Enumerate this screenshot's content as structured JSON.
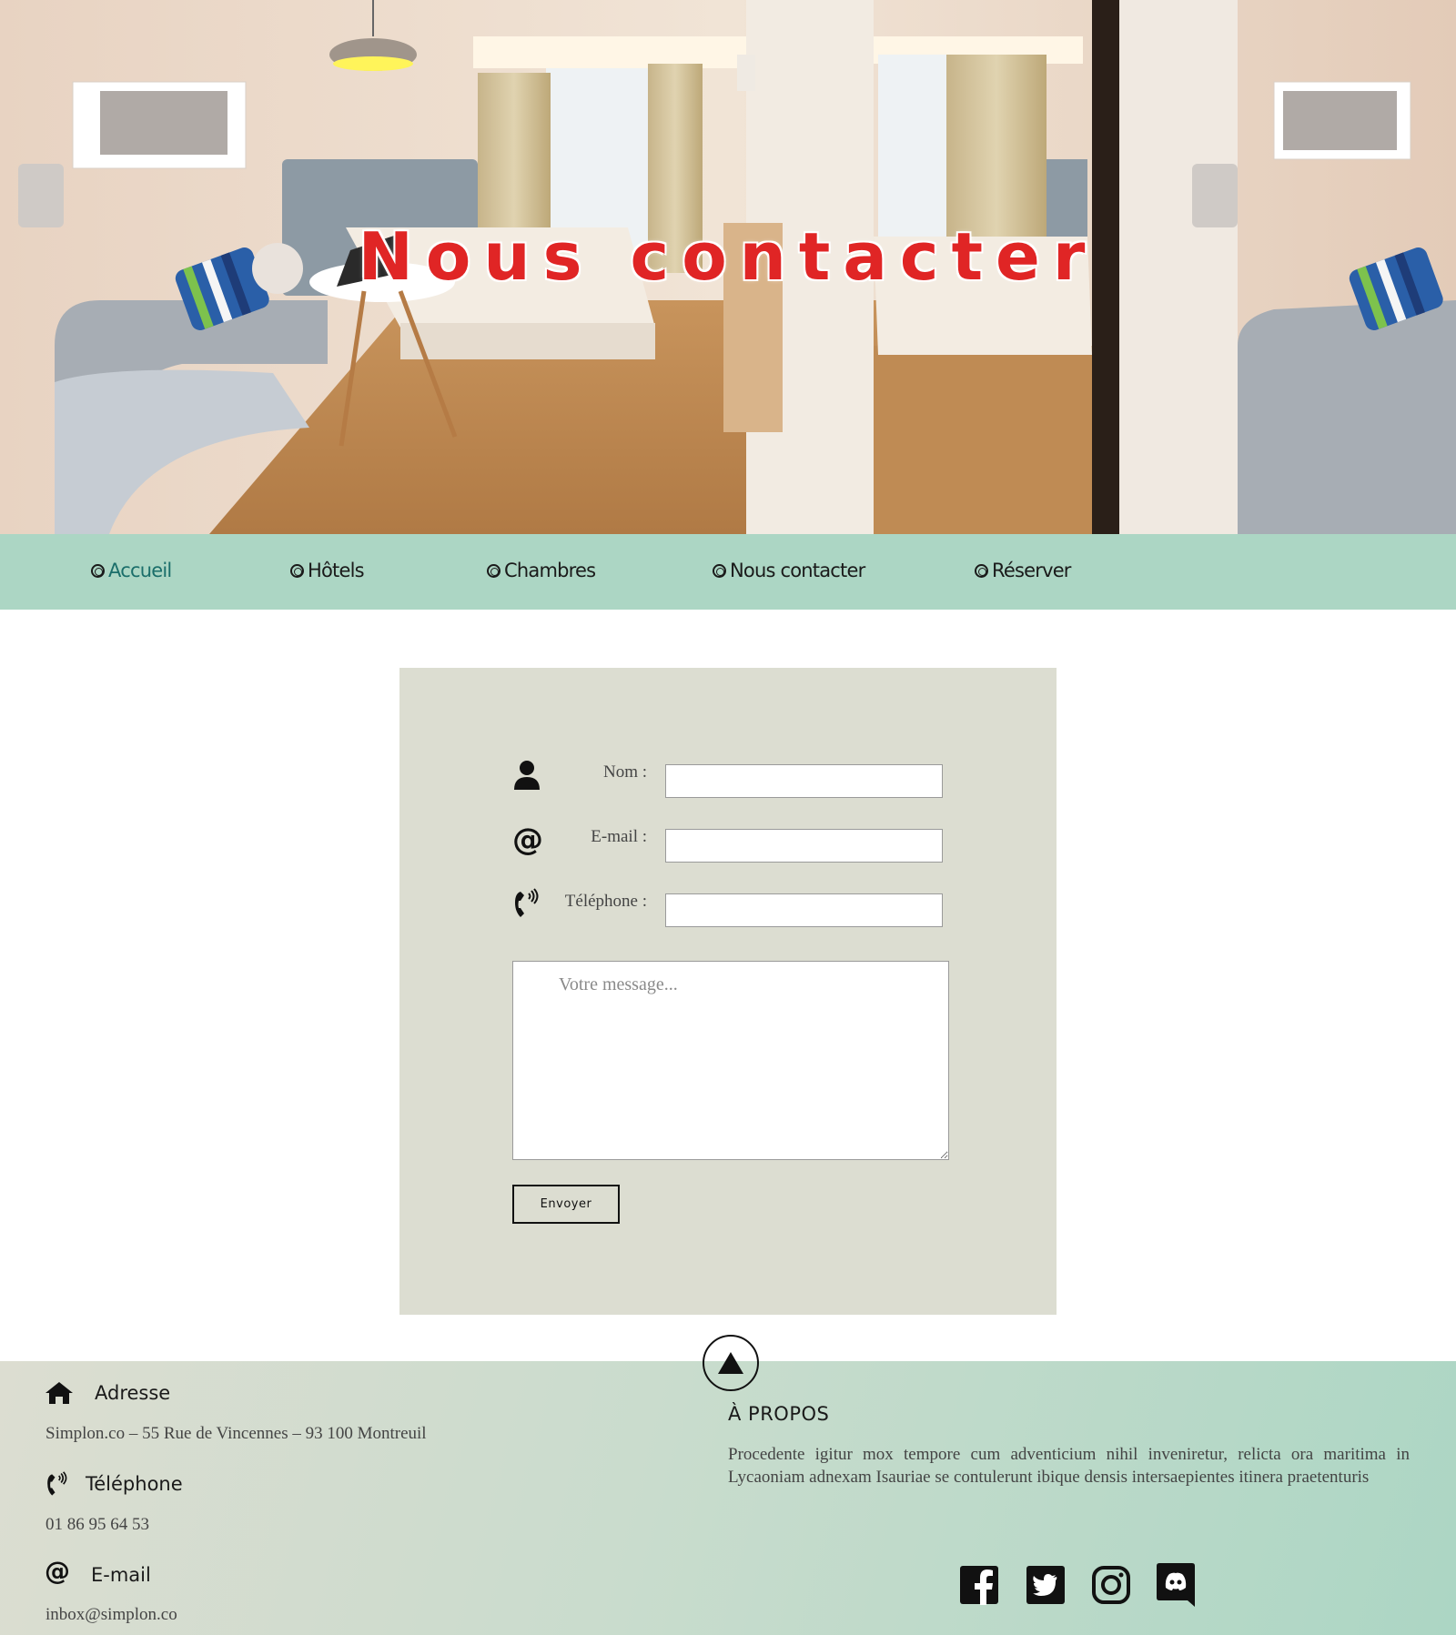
{
  "hero": {
    "title": "Nous contacter"
  },
  "nav": {
    "items": [
      {
        "label": "Accueil"
      },
      {
        "label": "Hôtels"
      },
      {
        "label": "Chambres"
      },
      {
        "label": "Nous contacter"
      },
      {
        "label": "Réserver"
      }
    ],
    "active_color": "#1a6e6a",
    "background": "#acd6c4"
  },
  "form": {
    "name_label": "Nom :",
    "email_label": "E-mail :",
    "phone_label": "Téléphone :",
    "message_placeholder": "Votre message...",
    "send_label": "Envoyer",
    "background": "#dcddd1"
  },
  "footer": {
    "address_heading": "Adresse",
    "address_text": "Simplon.co – 55 Rue de Vincennes – 93 100 Montreuil",
    "phone_heading": "Téléphone",
    "phone_text": "01 86 95 64 53",
    "email_heading": "E-mail",
    "email_text": "inbox@simplon.co",
    "about_title": "À PROPOS",
    "about_text": "Procedente igitur mox tempore cum adventicium nihil inveniretur, relicta ora maritima in Lycaoniam adnexam Isauriae se contulerunt ibique densis intersaepientes itinera praetenturis",
    "social": [
      "facebook-icon",
      "twitter-icon",
      "instagram-icon",
      "discord-icon"
    ]
  },
  "icons": {
    "name": "person-icon",
    "email": "at-icon",
    "phone": "phone-icon",
    "home": "home-icon",
    "back_to_top": "arrow-up-icon"
  }
}
